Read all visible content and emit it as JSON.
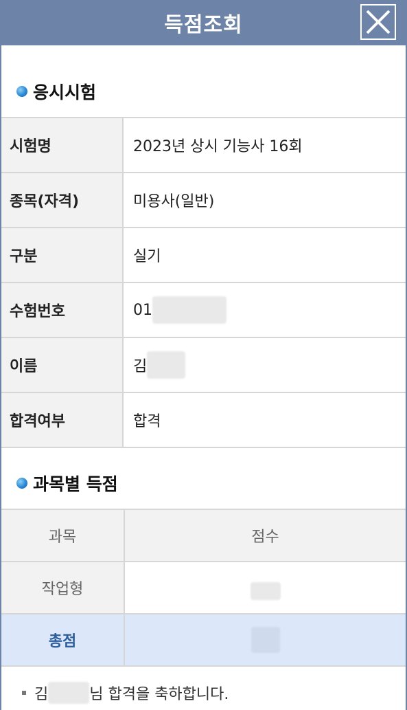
{
  "title": "득점조회",
  "close_icon": "close-icon",
  "section1": {
    "label": "응시시험"
  },
  "info": [
    {
      "key": "시험명",
      "value": "2023년 상시 기능사 16회"
    },
    {
      "key": "종목(자격)",
      "value": "미용사(일반)"
    },
    {
      "key": "구분",
      "value": "실기"
    },
    {
      "key": "수험번호",
      "value": "01"
    },
    {
      "key": "이름",
      "value": "김"
    },
    {
      "key": "합격여부",
      "value": "합격"
    }
  ],
  "section2": {
    "label": "과목별 득점"
  },
  "score_table": {
    "col_subject": "과목",
    "col_score": "점수",
    "rows": [
      {
        "subject": "작업형",
        "score": ""
      }
    ],
    "total_label": "총점",
    "total_value": ""
  },
  "footer": {
    "prefix": "김",
    "suffix": "님 합격을 축하합니다."
  },
  "colors": {
    "header_bg": "#6d84a8",
    "total_bg": "#dce8fa",
    "total_text": "#2d5d9c"
  }
}
